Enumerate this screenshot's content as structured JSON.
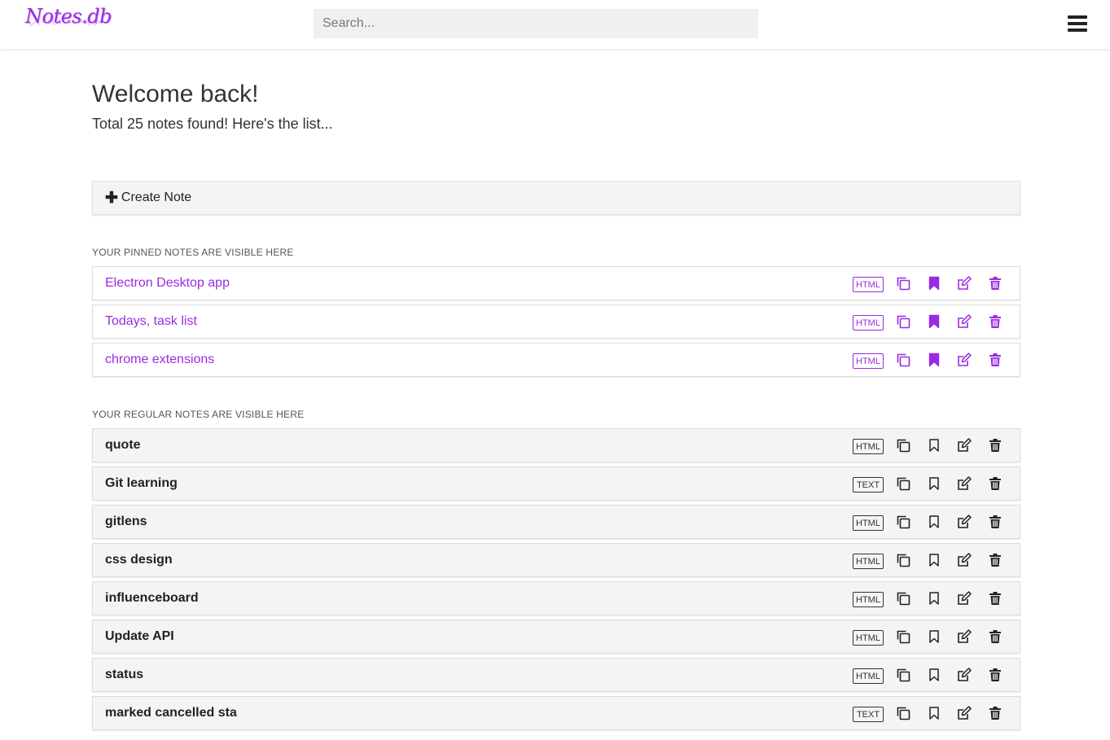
{
  "header": {
    "logo_text": "Notes.db",
    "search_placeholder": "Search...",
    "menu_icon": "hamburger-icon"
  },
  "welcome": {
    "title": "Welcome back!",
    "subtitle": "Total 25 notes found! Here's the list..."
  },
  "create": {
    "icon": "plus-icon",
    "label": "Create Note"
  },
  "pinned": {
    "section_label": "YOUR PINNED NOTES ARE VISIBLE HERE",
    "items": [
      {
        "title": "Electron Desktop app",
        "type": "HTML"
      },
      {
        "title": "Todays, task list",
        "type": "HTML"
      },
      {
        "title": "chrome extensions",
        "type": "HTML"
      }
    ]
  },
  "regular": {
    "section_label": "YOUR REGULAR NOTES ARE VISIBLE HERE",
    "items": [
      {
        "title": "quote",
        "type": "HTML"
      },
      {
        "title": "Git learning",
        "type": "TEXT"
      },
      {
        "title": "gitlens",
        "type": "HTML"
      },
      {
        "title": "css design",
        "type": "HTML"
      },
      {
        "title": "influenceboard",
        "type": "HTML"
      },
      {
        "title": "Update API",
        "type": "HTML"
      },
      {
        "title": "status",
        "type": "HTML"
      },
      {
        "title": "marked cancelled sta",
        "type": "TEXT"
      }
    ]
  },
  "action_icons": [
    "copy-icon",
    "bookmark-icon",
    "edit-icon",
    "trash-icon"
  ],
  "colors": {
    "accent": "#9a2be2",
    "regular_row_bg": "#f4f4f4",
    "search_bg": "#f0f0f0"
  }
}
